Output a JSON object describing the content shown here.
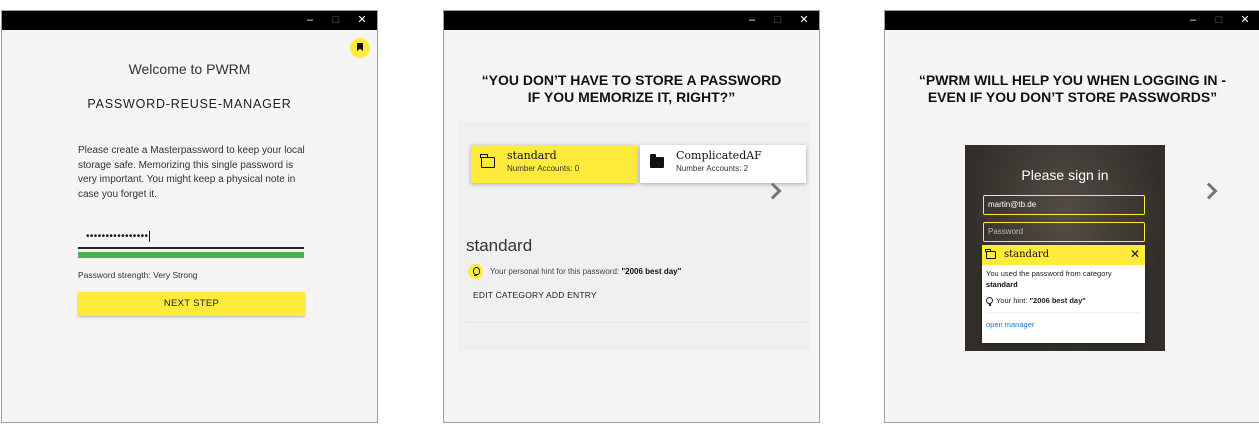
{
  "colors": {
    "accent": "#ffeb3b",
    "strength": "#4caf50",
    "link": "#1976d2"
  },
  "window_controls": {
    "minimize": "–",
    "maximize": "□",
    "close": "✕"
  },
  "screen1": {
    "welcome": "Welcome to PWRM",
    "title": "PASSWORD-REUSE-MANAGER",
    "description": "Please create a Masterpassword to keep your local storage safe. Memorizing this single password is very important. You might keep a physical note in case you forget it.",
    "password_value": "••••••••••••••••",
    "strength_fraction": 1.0,
    "strength_text": "Password strength: Very Strong",
    "next_label": "NEXT STEP",
    "bookmark_icon": "bookmark-icon"
  },
  "screen2": {
    "headline_line1": "“YOU DON’T HAVE TO STORE A PASSWORD",
    "headline_line2": "IF YOU MEMORIZE IT, RIGHT?”",
    "categories": [
      {
        "name": "standard",
        "sub": "Number Accounts: 0"
      },
      {
        "name": "ComplicatedAF",
        "sub": "Number Accounts: 2"
      }
    ],
    "heading": "standard",
    "hint_prefix": "Your personal hint for this password: ",
    "hint_value": "\"2006 best day\"",
    "edit_label": "EDIT CATEGORY",
    "add_label": "ADD ENTRY"
  },
  "screen3": {
    "headline_line1": "“PWRM WILL HELP YOU WHEN LOGGING IN -",
    "headline_line2": "EVEN IF YOU DON’T STORE PASSWORDS”",
    "signin_title": "Please sign in",
    "email_value": "martin@tb.de",
    "password_placeholder": "Password",
    "popup_category": "standard",
    "popup_close": "✕",
    "popup_text": "You used the password from category ",
    "popup_text_bold": "standard",
    "hint_prefix": "Your hint: ",
    "hint_value": "\"2006 best day\"",
    "open_manager": "open manager"
  }
}
